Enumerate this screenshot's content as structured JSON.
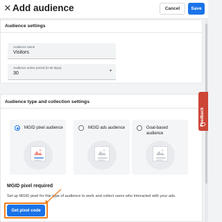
{
  "header": {
    "title": "Add audience",
    "cancel_label": "Cancel",
    "save_label": "Save"
  },
  "audience_settings": {
    "heading": "Audience settings",
    "name_field": {
      "label": "Audience name",
      "value": "Visitors"
    },
    "period_field": {
      "label": "Audience active period (0-30 days)",
      "value": "30"
    }
  },
  "collection_settings": {
    "heading": "Audience type and collection settings",
    "options": [
      {
        "label": "MGID pixel audience",
        "selected": true
      },
      {
        "label": "MGID ads audience",
        "selected": false
      },
      {
        "label": "Goal-based audience",
        "selected": false
      }
    ],
    "pixel_section": {
      "title": "MGID pixel required",
      "description": "Set up MGID pixel for this type of audience to work and collect users who interacted with your ads.",
      "button_label": "Get pixel code"
    }
  },
  "feedback_tab": {
    "label": "Feedback"
  },
  "colors": {
    "primary": "#1a73e8",
    "highlight": "#f07e1b",
    "feedback": "#cc4637"
  }
}
